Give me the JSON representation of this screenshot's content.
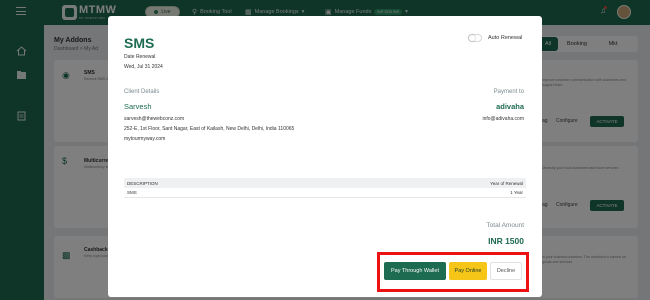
{
  "topbar": {
    "logo_text": "MTMW",
    "logo_subtitle": "MY TOUR MY WAY",
    "live_label": "Live",
    "nav": [
      {
        "icon": "search-icon",
        "label": "Booking Tool"
      },
      {
        "icon": "calendar-icon",
        "label": "Manage Bookings"
      },
      {
        "icon": "wallet-icon",
        "label": "Manage Funds",
        "badge": "INR 2525 INR"
      }
    ]
  },
  "page": {
    "title": "My Addons",
    "breadcrumb": "Dashboard  >  My Ad",
    "tabs": [
      "All",
      "Booking",
      "Mkt"
    ],
    "active_tab": "All"
  },
  "cards": [
    {
      "title": "SMS",
      "desc": "Receive SMS notification through your",
      "desc_right": "Improve customer communication with customers and support them",
      "configure": "Configure",
      "activate": "ACTIVATE",
      "extra": "ag"
    },
    {
      "title": "Multicurrency",
      "desc": "Multicurrency implementation",
      "desc_right": "Diversify your local customers fast travel services",
      "configure": "Configure",
      "activate": "ACTIVATE",
      "extra": "ag"
    },
    {
      "title": "Cashback",
      "desc": "Keep loyal customers attractive cashback",
      "desc_right": "to your business travelers. The cashback is earned on goods and services",
      "configure": "",
      "activate": "",
      "extra": ""
    }
  ],
  "modal": {
    "title": "SMS",
    "auto_renewal_label": "Auto Renewal",
    "auto_renewal_enabled": false,
    "date_renewal_label": "Date Renewal",
    "date_renewal_value": "Wed, Jul 31 2024",
    "client_details_label": "Client Details",
    "client_name": "Sarvesh",
    "client_email": "sarvesh@thewebconz.com",
    "client_address": "252-E, 1st Floor, Sant Nagar, East of Kailash, New Delhi, Delhi, India 110065",
    "client_website": "mytourmyway.com",
    "payment_to_label": "Payment to",
    "payee_name": "adivaha",
    "payee_email": "info@adivaha.com",
    "table": {
      "headers": [
        "DESCRIPTION",
        "Year of Renewal"
      ],
      "rows": [
        [
          "SMS",
          "1 Year"
        ]
      ]
    },
    "total_amount_label": "Total Amount",
    "total_amount_value": "INR 1500",
    "buttons": {
      "wallet": "Pay Through Wallet",
      "online": "Pay Online",
      "decline": "Decline"
    }
  },
  "colors": {
    "brand_green": "#1d6b50",
    "accent_yellow": "#f5c518",
    "highlight_red": "#ee1111"
  }
}
